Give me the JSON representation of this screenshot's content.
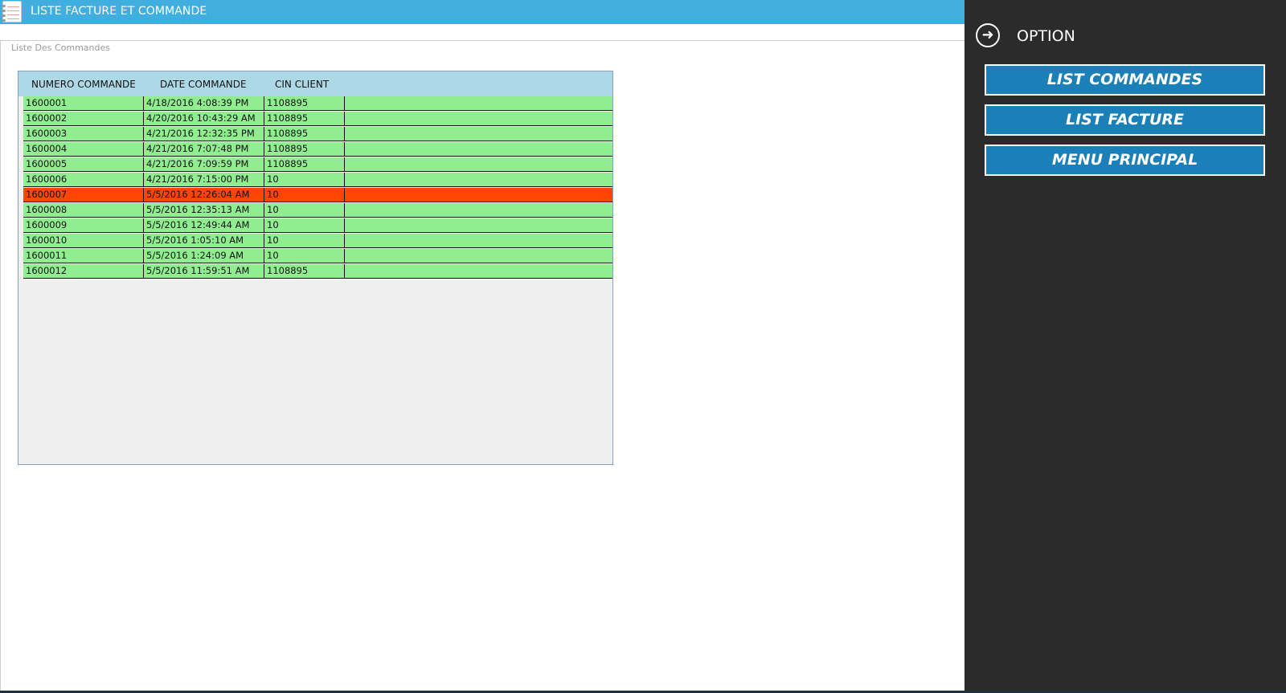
{
  "window": {
    "title": "LISTE FACTURE ET COMMANDE",
    "icon": "notebook-icon",
    "group_label": "Liste Des Commandes"
  },
  "grid": {
    "columns": [
      "NUMERO COMMANDE",
      "DATE COMMANDE",
      "CIN CLIENT"
    ],
    "rows": [
      [
        "1600001",
        "4/18/2016 4:08:39 PM",
        "1108895"
      ],
      [
        "1600002",
        "4/20/2016 10:43:29 AM",
        "1108895"
      ],
      [
        "1600003",
        "4/21/2016 12:32:35 PM",
        "1108895"
      ],
      [
        "1600004",
        "4/21/2016 7:07:48 PM",
        "1108895"
      ],
      [
        "1600005",
        "4/21/2016 7:09:59 PM",
        "1108895"
      ],
      [
        "1600006",
        "4/21/2016 7:15:00 PM",
        "10"
      ],
      [
        "1600007",
        "5/5/2016 12:26:04 AM",
        "10"
      ],
      [
        "1600008",
        "5/5/2016 12:35:13 AM",
        "10"
      ],
      [
        "1600009",
        "5/5/2016 12:49:44 AM",
        "10"
      ],
      [
        "1600010",
        "5/5/2016 1:05:10 AM",
        "10"
      ],
      [
        "1600011",
        "5/5/2016 1:24:09 AM",
        "10"
      ],
      [
        "1600012",
        "5/5/2016 11:59:51 AM",
        "1108895"
      ]
    ],
    "selected_index": 6,
    "colors": {
      "header": "#add8e6",
      "row": "#90ee90",
      "selected": "#ff4500"
    }
  },
  "panel": {
    "back_icon": "arrow-right-circle-icon",
    "title": "OPTION",
    "buttons": [
      "LIST COMMANDES",
      "LIST FACTURE",
      "MENU PRINCIPAL"
    ]
  },
  "colors": {
    "titlebar": "#41aee0",
    "panel_bg": "#2b2b2b",
    "button": "#1b80b8"
  }
}
